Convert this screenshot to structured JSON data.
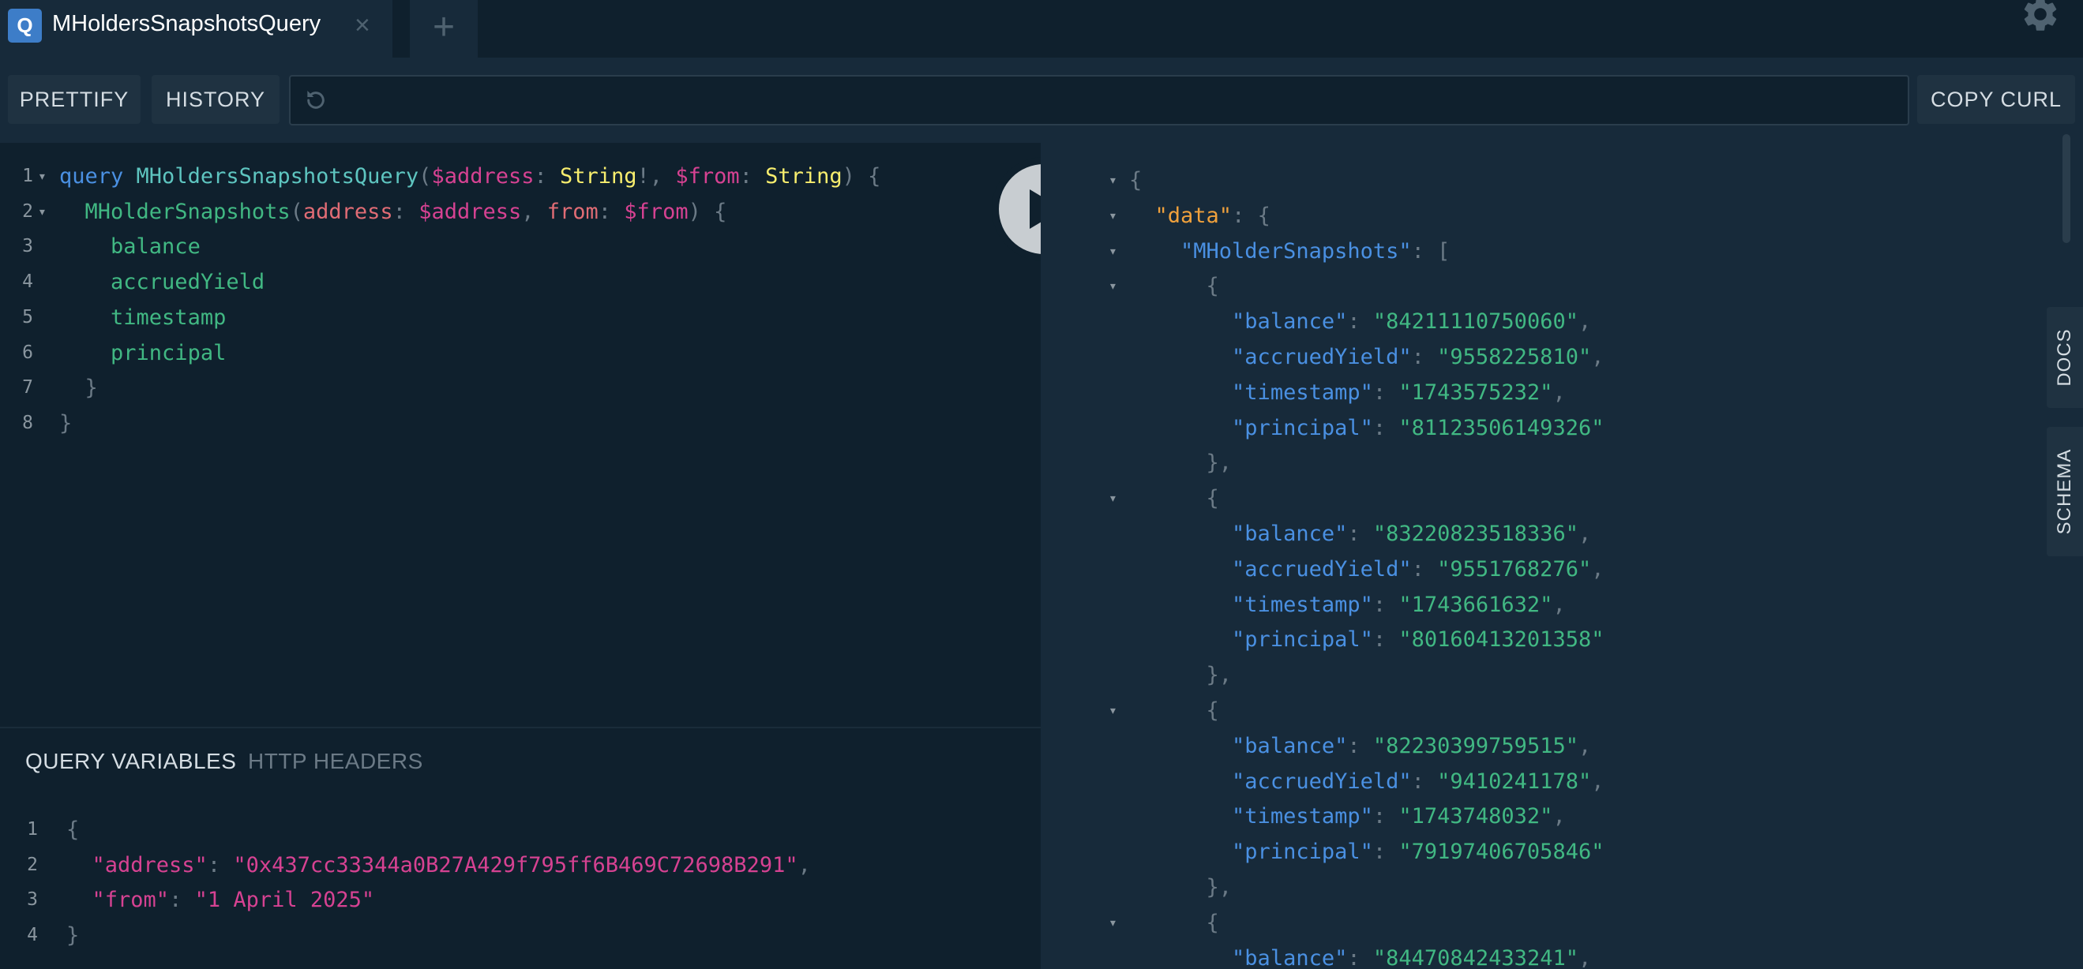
{
  "tab": {
    "badge": "Q",
    "title": "MHoldersSnapshotsQuery",
    "close": "×",
    "add": "+"
  },
  "toolbar": {
    "prettify": "PRETTIFY",
    "history": "HISTORY",
    "copy_curl": "COPY CURL"
  },
  "query_lines": [
    {
      "n": "1",
      "fold": "▾",
      "t": [
        [
          "kw",
          "query "
        ],
        [
          "op",
          "MHoldersSnapshotsQuery"
        ],
        [
          "pun",
          "("
        ],
        [
          "var",
          "$address"
        ],
        [
          "pun",
          ": "
        ],
        [
          "typ",
          "String"
        ],
        [
          "pun",
          "!, "
        ],
        [
          "var",
          "$from"
        ],
        [
          "pun",
          ": "
        ],
        [
          "typ",
          "String"
        ],
        [
          "pun",
          ") {"
        ]
      ]
    },
    {
      "n": "2",
      "fold": "▾",
      "t": [
        [
          "pun",
          "  "
        ],
        [
          "fld",
          "MHolderSnapshots"
        ],
        [
          "pun",
          "("
        ],
        [
          "arg",
          "address"
        ],
        [
          "pun",
          ": "
        ],
        [
          "var",
          "$address"
        ],
        [
          "pun",
          ", "
        ],
        [
          "arg",
          "from"
        ],
        [
          "pun",
          ": "
        ],
        [
          "var",
          "$from"
        ],
        [
          "pun",
          ") {"
        ]
      ]
    },
    {
      "n": "3",
      "fold": "",
      "t": [
        [
          "pun",
          "    "
        ],
        [
          "fld",
          "balance"
        ]
      ]
    },
    {
      "n": "4",
      "fold": "",
      "t": [
        [
          "pun",
          "    "
        ],
        [
          "fld",
          "accruedYield"
        ]
      ]
    },
    {
      "n": "5",
      "fold": "",
      "t": [
        [
          "pun",
          "    "
        ],
        [
          "fld",
          "timestamp"
        ]
      ]
    },
    {
      "n": "6",
      "fold": "",
      "t": [
        [
          "pun",
          "    "
        ],
        [
          "fld",
          "principal"
        ]
      ]
    },
    {
      "n": "7",
      "fold": "",
      "t": [
        [
          "pun",
          "  }"
        ]
      ]
    },
    {
      "n": "8",
      "fold": "",
      "t": [
        [
          "pun",
          "}"
        ]
      ]
    }
  ],
  "vars_tabs": {
    "query_variables": "QUERY VARIABLES",
    "http_headers": "HTTP HEADERS"
  },
  "var_lines": [
    {
      "n": "1",
      "t": [
        [
          "pun",
          "{"
        ]
      ]
    },
    {
      "n": "2",
      "t": [
        [
          "pun",
          "  "
        ],
        [
          "key",
          "\"address\""
        ],
        [
          "pun",
          ": "
        ],
        [
          "str",
          "\"0x437cc33344a0B27A429f795ff6B469C72698B291\""
        ],
        [
          "pun",
          ","
        ]
      ]
    },
    {
      "n": "3",
      "t": [
        [
          "pun",
          "  "
        ],
        [
          "key",
          "\"from\""
        ],
        [
          "pun",
          ": "
        ],
        [
          "str",
          "\"1 April 2025\""
        ]
      ]
    },
    {
      "n": "4",
      "t": [
        [
          "pun",
          "}"
        ]
      ]
    }
  ],
  "result_lines": [
    {
      "fold": "▾",
      "t": [
        [
          "pun",
          "{"
        ]
      ]
    },
    {
      "fold": "▾",
      "t": [
        [
          "pun",
          "  "
        ],
        [
          "rdata",
          "\"data\""
        ],
        [
          "pun",
          ": {"
        ]
      ]
    },
    {
      "fold": "▾",
      "t": [
        [
          "pun",
          "    "
        ],
        [
          "rkey",
          "\"MHolderSnapshots\""
        ],
        [
          "pun",
          ": ["
        ]
      ]
    },
    {
      "fold": "▾",
      "t": [
        [
          "pun",
          "      {"
        ]
      ]
    },
    {
      "fold": "",
      "t": [
        [
          "pun",
          "        "
        ],
        [
          "rkey",
          "\"balance\""
        ],
        [
          "pun",
          ": "
        ],
        [
          "rstr",
          "\"84211110750060\""
        ],
        [
          "pun",
          ","
        ]
      ]
    },
    {
      "fold": "",
      "t": [
        [
          "pun",
          "        "
        ],
        [
          "rkey",
          "\"accruedYield\""
        ],
        [
          "pun",
          ": "
        ],
        [
          "rstr",
          "\"9558225810\""
        ],
        [
          "pun",
          ","
        ]
      ]
    },
    {
      "fold": "",
      "t": [
        [
          "pun",
          "        "
        ],
        [
          "rkey",
          "\"timestamp\""
        ],
        [
          "pun",
          ": "
        ],
        [
          "rstr",
          "\"1743575232\""
        ],
        [
          "pun",
          ","
        ]
      ]
    },
    {
      "fold": "",
      "t": [
        [
          "pun",
          "        "
        ],
        [
          "rkey",
          "\"principal\""
        ],
        [
          "pun",
          ": "
        ],
        [
          "rstr",
          "\"81123506149326\""
        ]
      ]
    },
    {
      "fold": "",
      "t": [
        [
          "pun",
          "      },"
        ]
      ]
    },
    {
      "fold": "▾",
      "t": [
        [
          "pun",
          "      {"
        ]
      ]
    },
    {
      "fold": "",
      "t": [
        [
          "pun",
          "        "
        ],
        [
          "rkey",
          "\"balance\""
        ],
        [
          "pun",
          ": "
        ],
        [
          "rstr",
          "\"83220823518336\""
        ],
        [
          "pun",
          ","
        ]
      ]
    },
    {
      "fold": "",
      "t": [
        [
          "pun",
          "        "
        ],
        [
          "rkey",
          "\"accruedYield\""
        ],
        [
          "pun",
          ": "
        ],
        [
          "rstr",
          "\"9551768276\""
        ],
        [
          "pun",
          ","
        ]
      ]
    },
    {
      "fold": "",
      "t": [
        [
          "pun",
          "        "
        ],
        [
          "rkey",
          "\"timestamp\""
        ],
        [
          "pun",
          ": "
        ],
        [
          "rstr",
          "\"1743661632\""
        ],
        [
          "pun",
          ","
        ]
      ]
    },
    {
      "fold": "",
      "t": [
        [
          "pun",
          "        "
        ],
        [
          "rkey",
          "\"principal\""
        ],
        [
          "pun",
          ": "
        ],
        [
          "rstr",
          "\"80160413201358\""
        ]
      ]
    },
    {
      "fold": "",
      "t": [
        [
          "pun",
          "      },"
        ]
      ]
    },
    {
      "fold": "▾",
      "t": [
        [
          "pun",
          "      {"
        ]
      ]
    },
    {
      "fold": "",
      "t": [
        [
          "pun",
          "        "
        ],
        [
          "rkey",
          "\"balance\""
        ],
        [
          "pun",
          ": "
        ],
        [
          "rstr",
          "\"82230399759515\""
        ],
        [
          "pun",
          ","
        ]
      ]
    },
    {
      "fold": "",
      "t": [
        [
          "pun",
          "        "
        ],
        [
          "rkey",
          "\"accruedYield\""
        ],
        [
          "pun",
          ": "
        ],
        [
          "rstr",
          "\"9410241178\""
        ],
        [
          "pun",
          ","
        ]
      ]
    },
    {
      "fold": "",
      "t": [
        [
          "pun",
          "        "
        ],
        [
          "rkey",
          "\"timestamp\""
        ],
        [
          "pun",
          ": "
        ],
        [
          "rstr",
          "\"1743748032\""
        ],
        [
          "pun",
          ","
        ]
      ]
    },
    {
      "fold": "",
      "t": [
        [
          "pun",
          "        "
        ],
        [
          "rkey",
          "\"principal\""
        ],
        [
          "pun",
          ": "
        ],
        [
          "rstr",
          "\"79197406705846\""
        ]
      ]
    },
    {
      "fold": "",
      "t": [
        [
          "pun",
          "      },"
        ]
      ]
    },
    {
      "fold": "▾",
      "t": [
        [
          "pun",
          "      {"
        ]
      ]
    },
    {
      "fold": "",
      "t": [
        [
          "pun",
          "        "
        ],
        [
          "rkey",
          "\"balance\""
        ],
        [
          "pun",
          ": "
        ],
        [
          "rstr",
          "\"84470842433241\""
        ],
        [
          "pun",
          ","
        ]
      ]
    }
  ],
  "side_tabs": {
    "docs": "DOCS",
    "schema": "SCHEMA"
  },
  "icons": {
    "gear": "gear-icon",
    "history": "history-icon",
    "play": "play-icon",
    "close": "close-icon",
    "add": "plus-icon"
  },
  "colors": {
    "background": "#172a3a",
    "editor_bg": "#0f202d",
    "keyword": "#4a90e2",
    "field": "#41b883",
    "variable": "#d64292",
    "type": "#f8ee6e"
  }
}
